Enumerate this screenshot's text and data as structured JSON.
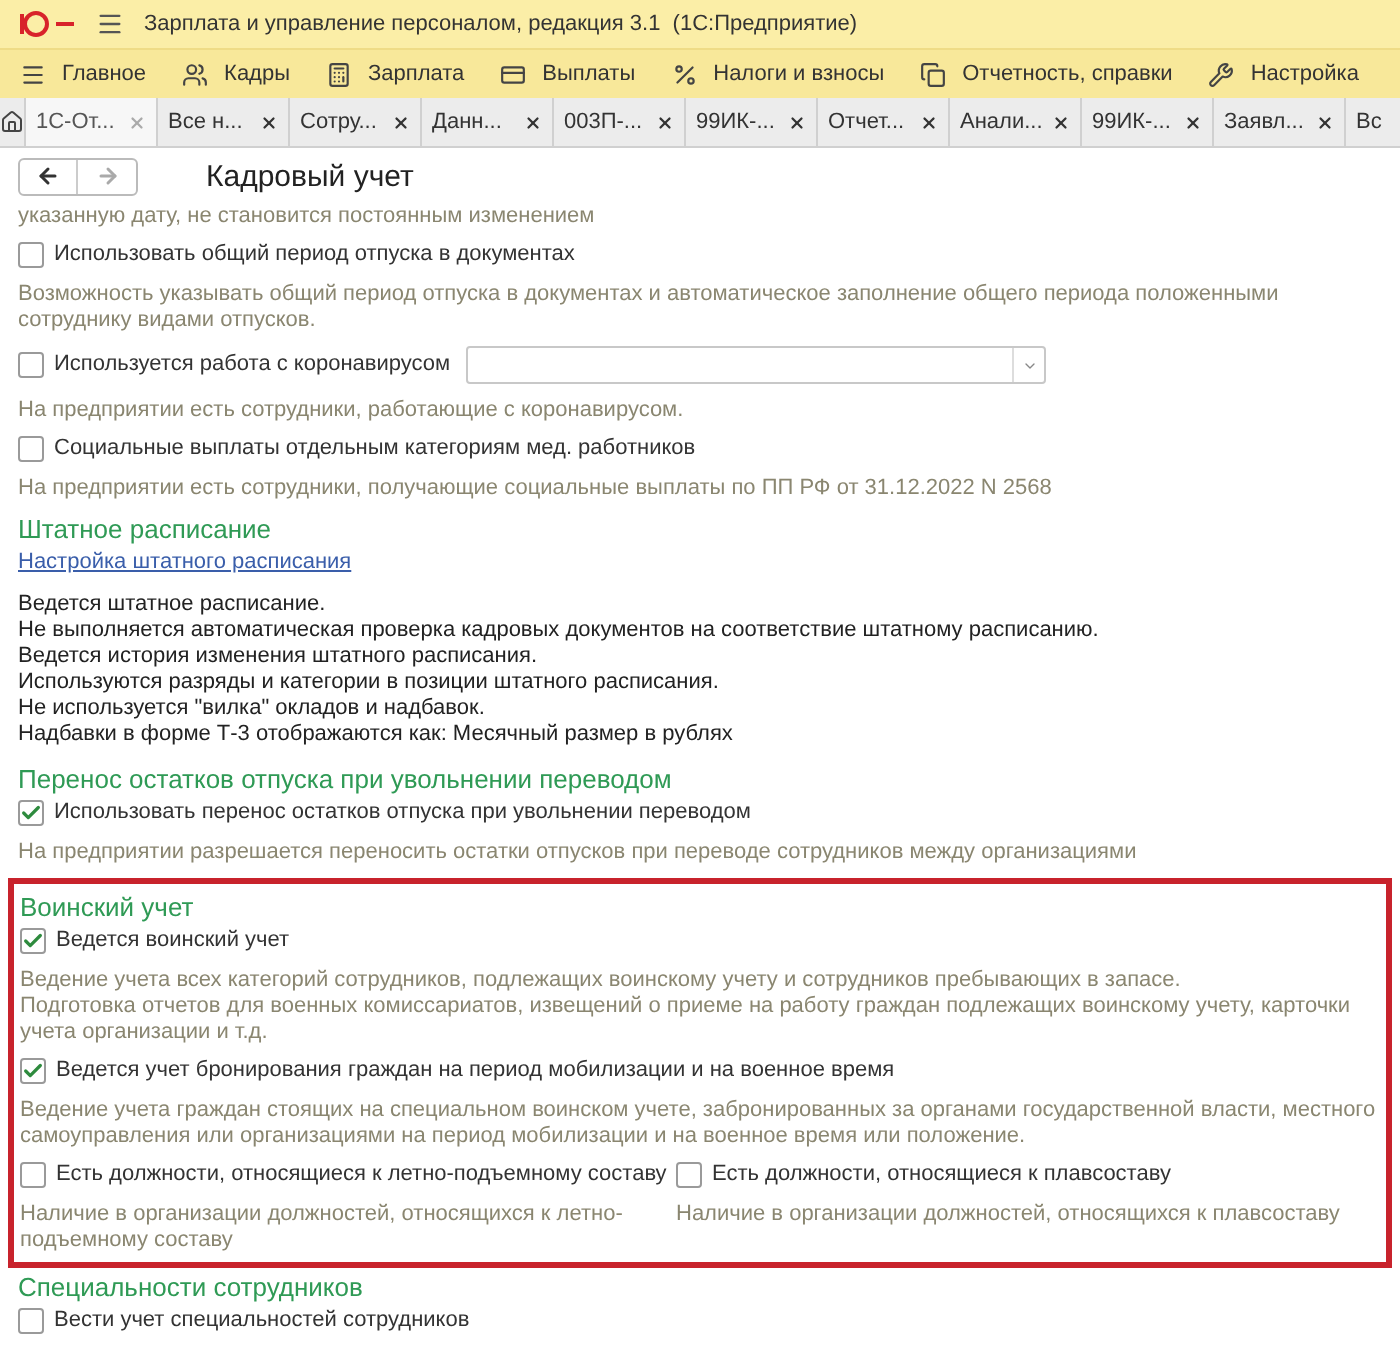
{
  "window": {
    "title": "Зарплата и управление персоналом, редакция 3.1  (1С:Предприятие)"
  },
  "menu": [
    {
      "label": "Главное"
    },
    {
      "label": "Кадры"
    },
    {
      "label": "Зарплата"
    },
    {
      "label": "Выплаты"
    },
    {
      "label": "Налоги и взносы"
    },
    {
      "label": "Отчетность, справки"
    },
    {
      "label": "Настройка"
    }
  ],
  "tabs": [
    {
      "label": "1С-От...",
      "selected": true
    },
    {
      "label": "Все н...",
      "selected": false
    },
    {
      "label": "Сотру...",
      "selected": false
    },
    {
      "label": "Данн...",
      "selected": false
    },
    {
      "label": "003П-...",
      "selected": false
    },
    {
      "label": "99ИК-...",
      "selected": false
    },
    {
      "label": "Отчет...",
      "selected": false
    },
    {
      "label": "Анали...",
      "selected": false
    },
    {
      "label": "99ИК-...",
      "selected": false
    },
    {
      "label": "Заявл...",
      "selected": false
    },
    {
      "label": "Вс",
      "selected": false
    }
  ],
  "page": {
    "title": "Кадровый учет"
  },
  "sections": [
    {
      "highlighted": false,
      "items": [
        {
          "kind": "hint",
          "text": "указанную дату, не становится постоянным изменением"
        },
        {
          "kind": "checkbox",
          "label": "Использовать общий период отпуска в документах",
          "checked": false
        },
        {
          "kind": "hint",
          "text": "Возможность указывать общий период отпуска в документах и автоматическое заполнение общего периода положенными сотруднику видами отпусков."
        },
        {
          "kind": "checkbox_select",
          "label": "Используется работа с коронавирусом",
          "checked": false
        },
        {
          "kind": "hint",
          "text": "На предприятии есть сотрудники, работающие с коронавирусом."
        },
        {
          "kind": "checkbox",
          "label": "Социальные выплаты отдельным категориям мед. работников",
          "checked": false
        },
        {
          "kind": "hint",
          "text": "На предприятии есть сотрудники, получающие социальные выплаты по ПП РФ от 31.12.2022 N 2568"
        },
        {
          "kind": "heading",
          "text": "Штатное расписание"
        },
        {
          "kind": "link",
          "text": "Настройка штатного расписания"
        },
        {
          "kind": "text",
          "lines": [
            "Ведется штатное расписание.",
            "Не выполняется автоматическая проверка кадровых документов на соответствие штатному расписанию.",
            "Ведется история изменения штатного расписания.",
            "Используются разряды и категории в позиции штатного расписания.",
            "Не используется \"вилка\" окладов и надбавок.",
            "Надбавки в форме Т-3 отображаются как: Месячный размер в рублях"
          ]
        },
        {
          "kind": "heading",
          "text": "Перенос остатков отпуска при увольнении переводом"
        },
        {
          "kind": "checkbox",
          "label": "Использовать перенос остатков отпуска при увольнении переводом",
          "checked": true
        },
        {
          "kind": "hint",
          "text": "На предприятии разрешается переносить остатки отпусков при переводе сотрудников между организациями"
        }
      ]
    },
    {
      "highlighted": true,
      "items": [
        {
          "kind": "heading",
          "text": "Воинский учет"
        },
        {
          "kind": "checkbox",
          "label": "Ведется воинский учет",
          "checked": true
        },
        {
          "kind": "hint",
          "text": "Ведение учета всех категорий сотрудников, подлежащих воинскому учету и сотрудников пребывающих в запасе.\nПодготовка отчетов для военных комиссариатов, извещений о приеме на работу граждан подлежащих воинскому учету, карточки учета организации и т.д."
        },
        {
          "kind": "checkbox",
          "label": "Ведется учет бронирования граждан на период мобилизации и на военное время",
          "checked": true
        },
        {
          "kind": "hint",
          "text": "Ведение учета граждан стоящих на специальном воинском учете, забронированных за органами государственной власти, местного самоуправления или организациями на период мобилизации и на военное время или положение."
        },
        {
          "kind": "columns",
          "columns": [
            {
              "label": "Есть должности, относящиеся к летно-подъемному составу",
              "checked": false,
              "hint": "Наличие в организации должностей, относящихся к летно-подъемному составу"
            },
            {
              "label": "Есть должности, относящиеся к плавсоставу",
              "checked": false,
              "hint": "Наличие в организации должностей, относящихся к плавсоставу"
            }
          ]
        }
      ]
    },
    {
      "highlighted": false,
      "items": [
        {
          "kind": "heading",
          "text": "Специальности сотрудников"
        },
        {
          "kind": "checkbox",
          "label": "Вести учет специальностей сотрудников",
          "checked": false
        }
      ]
    }
  ]
}
